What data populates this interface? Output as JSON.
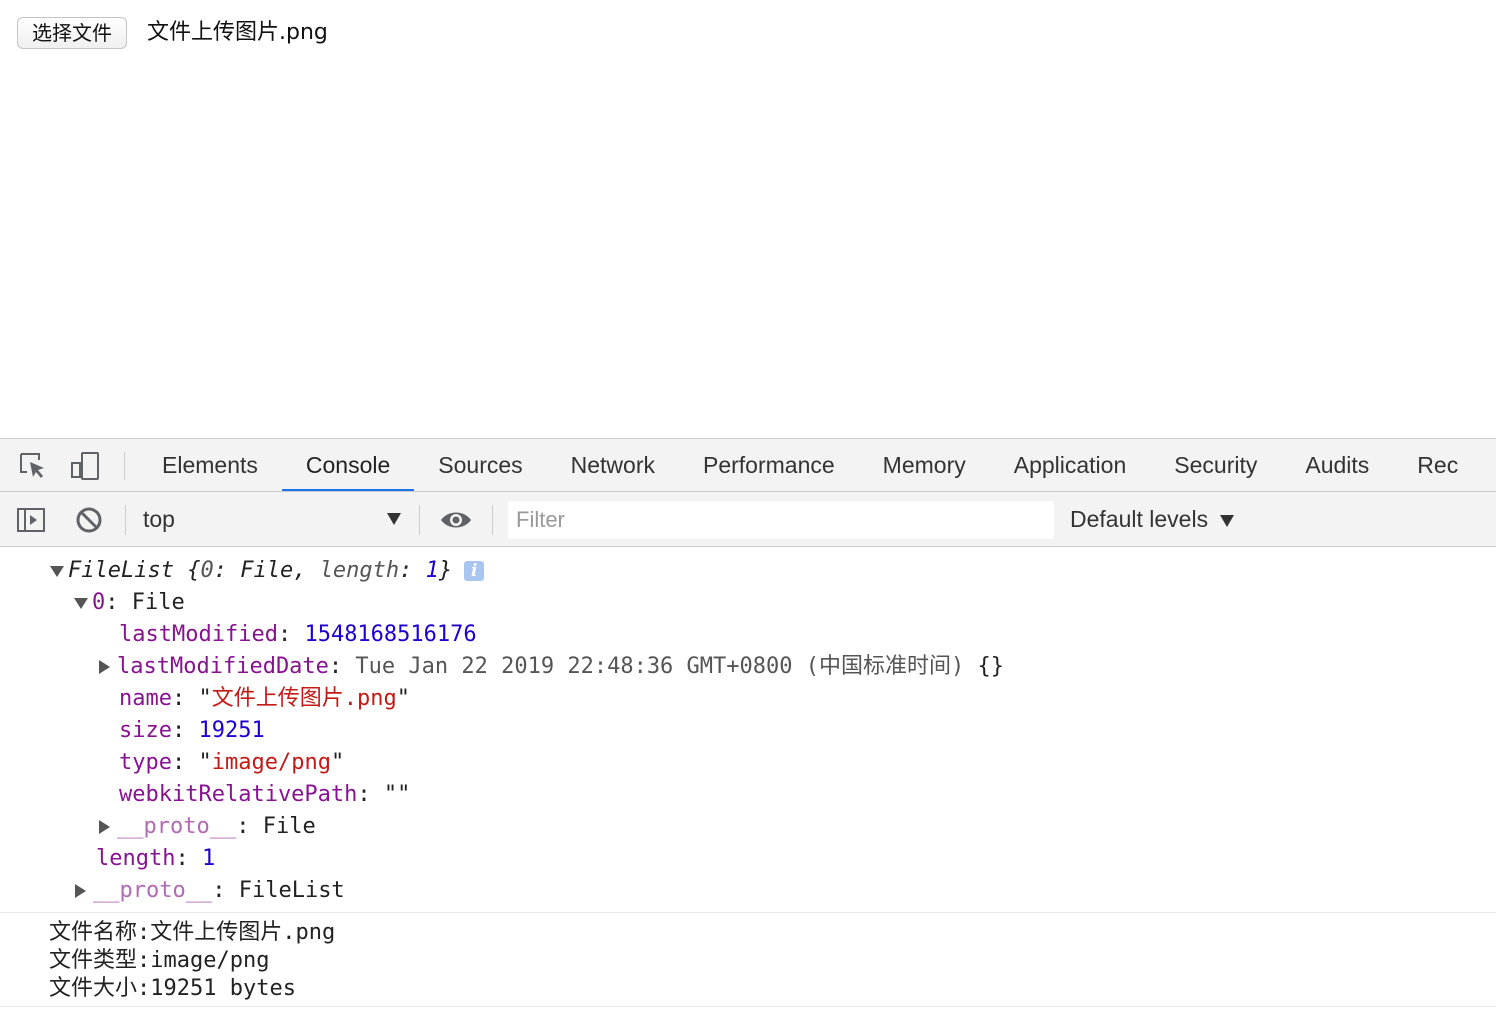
{
  "page": {
    "file_button_label": "选择文件",
    "file_name": "文件上传图片.png"
  },
  "devtools": {
    "tabs": [
      "Elements",
      "Console",
      "Sources",
      "Network",
      "Performance",
      "Memory",
      "Application",
      "Security",
      "Audits",
      "Rec"
    ],
    "active_tab": "Console",
    "accent_color": "#1a73e8",
    "toolbar": {
      "context": "top",
      "filter_placeholder": "Filter",
      "levels_label": "Default levels"
    },
    "icons": {
      "inspect": "inspect-element-icon",
      "device": "device-toolbar-icon",
      "sidebar": "show-sidebar-icon",
      "clear": "clear-console-icon",
      "eye": "live-expression-eye-icon",
      "info": "info-icon"
    }
  },
  "console": {
    "filelist_header": {
      "name": "FileList",
      "open": " {",
      "k0": "0",
      "v0": ": File, ",
      "k1": "length",
      "colon": ": ",
      "v1": "1",
      "close": "}",
      "info": "i"
    },
    "file_entry": {
      "key": "0",
      "value": "File"
    },
    "props": {
      "lastModified": {
        "key": "lastModified",
        "value": "1548168516176"
      },
      "lastModifiedDate": {
        "key": "lastModifiedDate",
        "value": "Tue Jan 22 2019 22:48:36 GMT+0800 (中国标准时间)",
        "suffix": " {}"
      },
      "name": {
        "key": "name",
        "value": "文件上传图片.png"
      },
      "size": {
        "key": "size",
        "value": "19251"
      },
      "type": {
        "key": "type",
        "value": "image/png"
      },
      "webkitRelativePath": {
        "key": "webkitRelativePath",
        "value": "\"\""
      },
      "file_proto": {
        "key": "__proto__",
        "value": "File"
      }
    },
    "length": {
      "key": "length",
      "value": "1"
    },
    "list_proto": {
      "key": "__proto__",
      "value": "FileList"
    },
    "logs": [
      "文件名称:文件上传图片.png",
      "文件类型:image/png",
      "文件大小:19251 bytes"
    ]
  }
}
